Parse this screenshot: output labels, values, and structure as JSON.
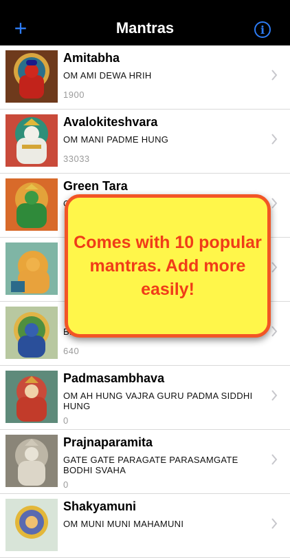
{
  "nav": {
    "title": "Mantras",
    "add_icon": "plus-icon",
    "info_icon": "info-icon"
  },
  "mantras": [
    {
      "name": "Amitabha",
      "mantra": "OM AMI DEWA HRIH",
      "count": "1900"
    },
    {
      "name": "Avalokiteshvara",
      "mantra": "OM MANI PADME HUNG",
      "count": "33033"
    },
    {
      "name": "Green Tara",
      "mantra": "O",
      "count": ""
    },
    {
      "name": "",
      "mantra": "",
      "count": ""
    },
    {
      "name": "",
      "mantra": "BL",
      "count": "640"
    },
    {
      "name": "Padmasambhava",
      "mantra": "OM AH HUNG VAJRA GURU PADMA SIDDHI HUNG",
      "count": "0"
    },
    {
      "name": "Prajnaparamita",
      "mantra": "GATE GATE PARAGATE PARASAMGATE BODHI SVAHA",
      "count": "0"
    },
    {
      "name": "Shakyamuni",
      "mantra": "OM MUNI MUNI MAHAMUNI",
      "count": ""
    }
  ],
  "promo": {
    "text": "Comes with 10 popular mantras. Add more easily!"
  },
  "colors": {
    "nav_bg": "#000000",
    "accent": "#2d7cf6",
    "promo_bg": "#fff64a",
    "promo_text": "#f03c18"
  }
}
